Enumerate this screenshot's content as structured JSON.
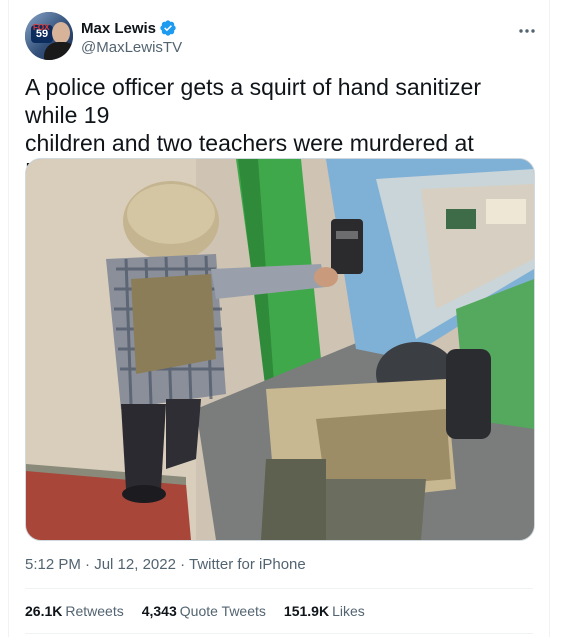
{
  "author": {
    "display_name": "Max Lewis",
    "handle": "@MaxLewisTV",
    "avatar_badge": "59",
    "avatar_badge_top": "FOX"
  },
  "tweet": {
    "text": "A police officer gets a squirt of hand sanitizer while 19\nchildren and two teachers were murdered at Robb\nElementary School in Uvalde, Texas",
    "time": "5:12 PM",
    "date": "Jul 12, 2022",
    "source": "Twitter for iPhone"
  },
  "stats": [
    {
      "count": "26.1K",
      "label": "Retweets"
    },
    {
      "count": "4,343",
      "label": "Quote Tweets"
    },
    {
      "count": "151.9K",
      "label": "Likes"
    }
  ],
  "colors": {
    "verified": "#1d9bf0",
    "text_secondary": "#536471",
    "border": "#eff3f4"
  }
}
